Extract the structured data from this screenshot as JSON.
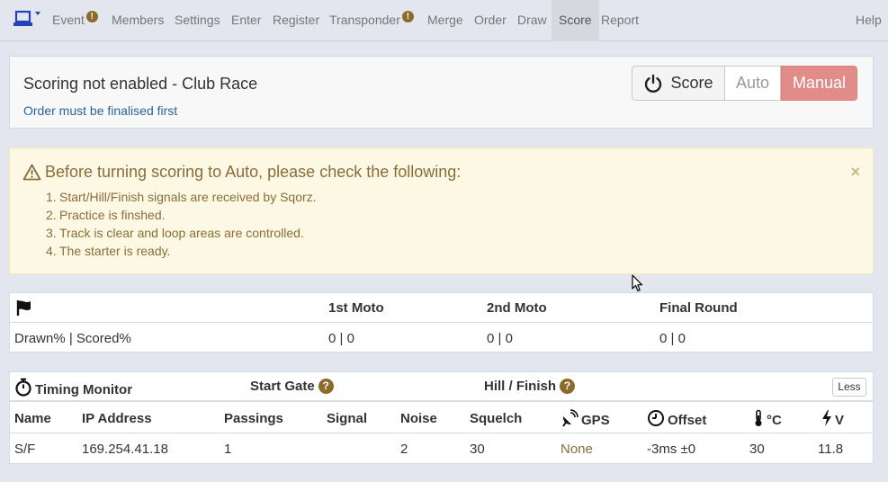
{
  "nav": {
    "brand_icon": "laptop-icon",
    "items": [
      {
        "label": "Event",
        "warn": "!"
      },
      {
        "label": "Members"
      },
      {
        "label": "Settings"
      },
      {
        "label": "Enter"
      },
      {
        "label": "Register"
      },
      {
        "label": "Transponder",
        "warn": "!"
      },
      {
        "label": "Merge"
      },
      {
        "label": "Order"
      },
      {
        "label": "Draw"
      },
      {
        "label": "Score",
        "active": true
      },
      {
        "label": "Report"
      }
    ],
    "help": "Help"
  },
  "status": {
    "title": "Scoring not enabled - Club Race",
    "subtitle": "Order must be finalised first",
    "buttons": {
      "score": "Score",
      "auto": "Auto",
      "manual": "Manual"
    },
    "colors": {
      "manual": "#e28c8a"
    }
  },
  "alert": {
    "title": "Before turning scoring to Auto, please check the following:",
    "close": "×",
    "items": [
      {
        "num": "1.",
        "text": "Start/Hill/Finish signals are received by Sqorz."
      },
      {
        "num": "2.",
        "text": "Practice is finshed."
      },
      {
        "num": "3.",
        "text": "Track is clear and loop areas are controlled."
      },
      {
        "num": "4.",
        "text": "The starter is ready."
      }
    ]
  },
  "moto_table": {
    "flag_icon": "flag-icon",
    "headers": [
      "1st Moto",
      "2nd Moto",
      "Final Round"
    ],
    "row_label": "Drawn% | Scored%",
    "values": [
      "0 | 0",
      "0 | 0",
      "0 | 0"
    ]
  },
  "timing": {
    "title": "Timing Monitor",
    "start_gate": "Start Gate",
    "hill_finish": "Hill / Finish",
    "help_mark": "?",
    "less_button": "Less",
    "columns": [
      "Name",
      "IP Address",
      "Passings",
      "Signal",
      "Noise",
      "Squelch",
      "GPS",
      "Offset",
      "°C",
      "V"
    ],
    "row": {
      "name": "S/F",
      "ip": "169.254.41.18",
      "passings": "1",
      "signal": "",
      "noise": "2",
      "squelch": "30",
      "gps": "None",
      "offset": "-3ms ±0",
      "temp": "30",
      "volts": "11.8"
    }
  }
}
